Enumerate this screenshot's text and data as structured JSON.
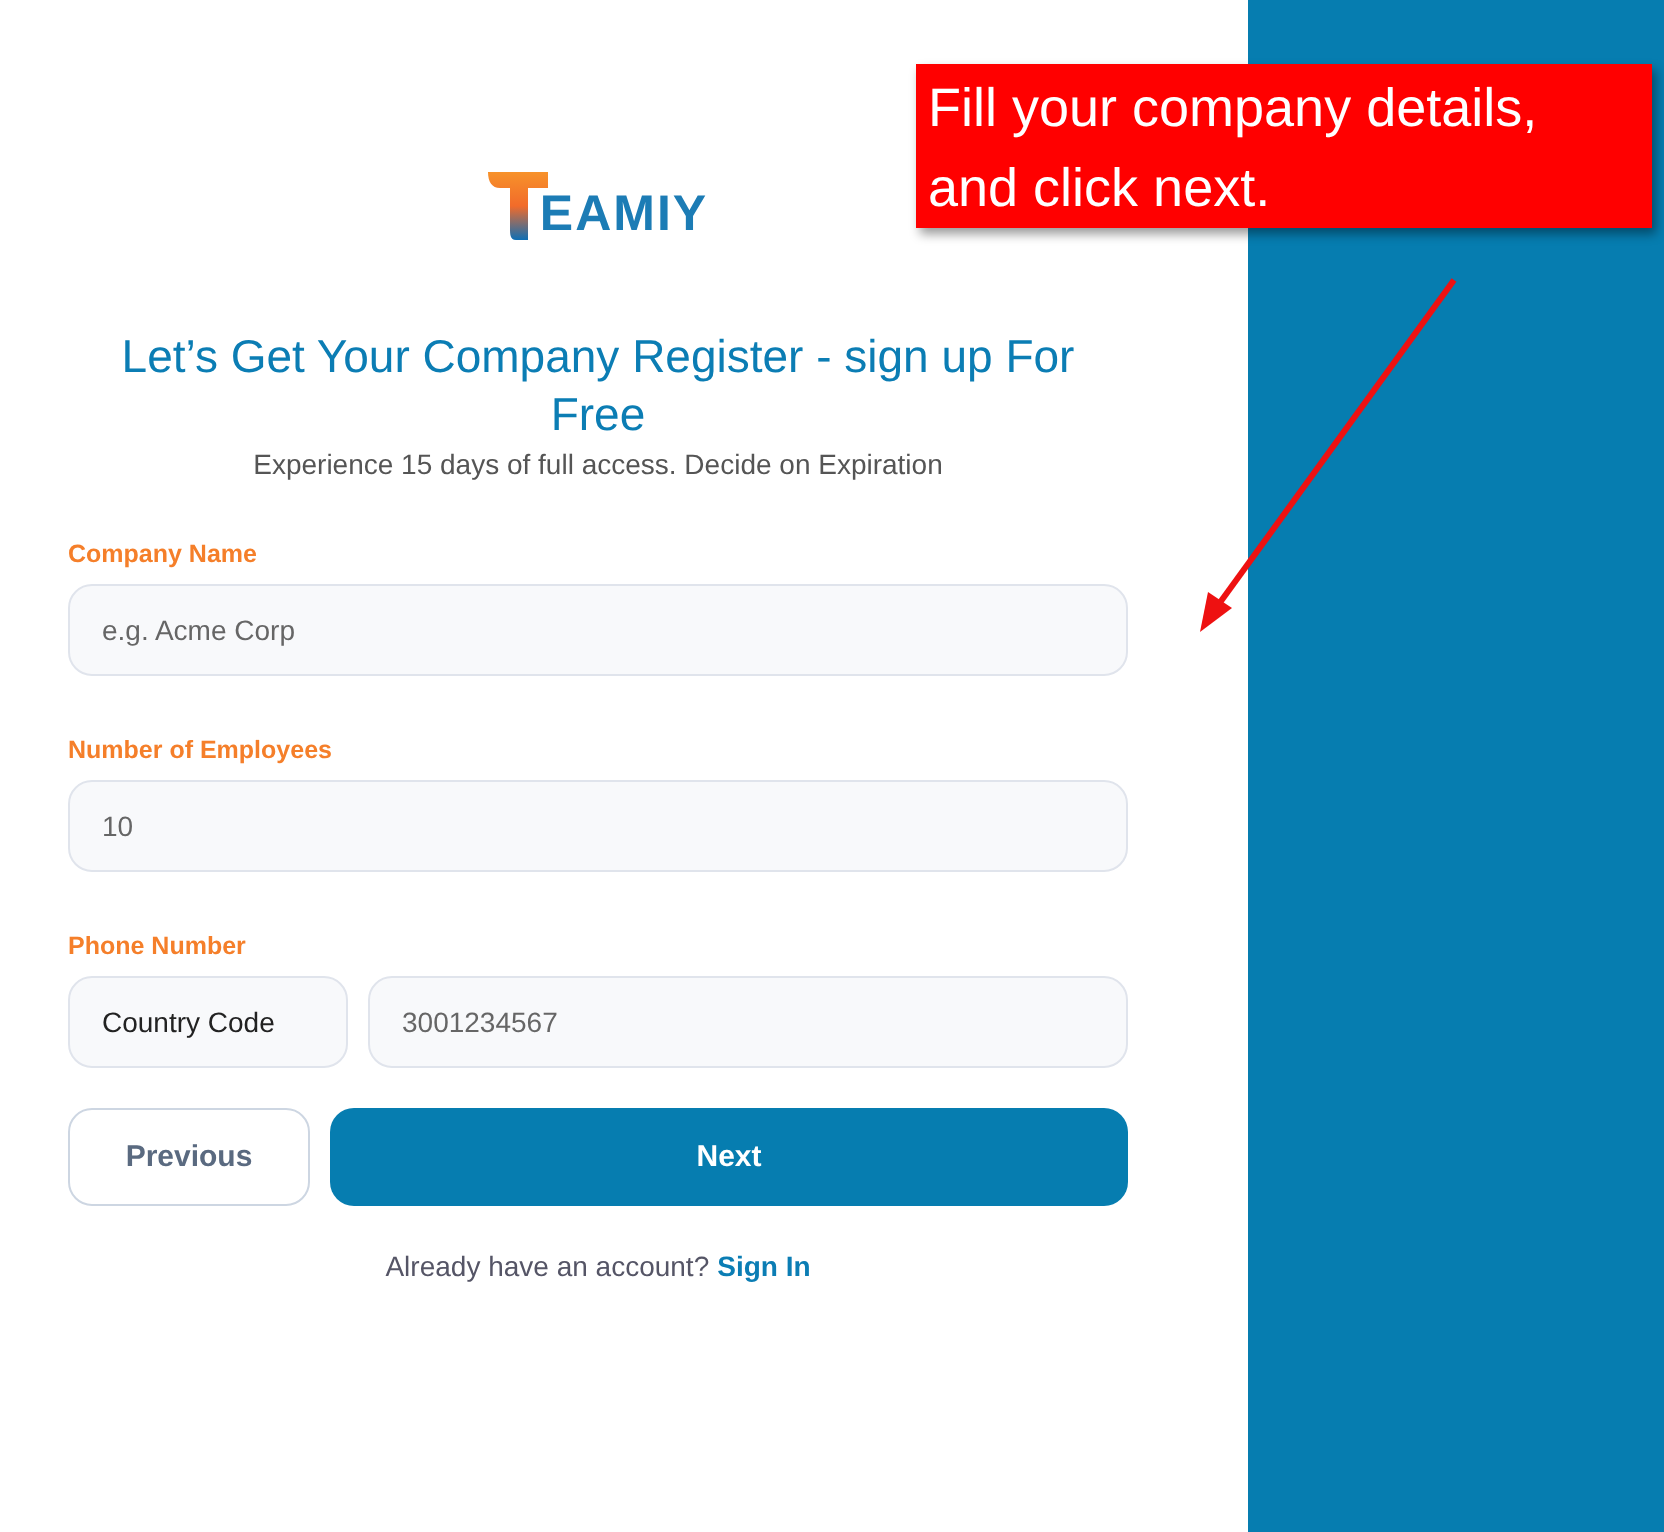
{
  "logo": {
    "text": "EAMIY"
  },
  "heading": "Let’s Get Your Company Register - sign up For Free",
  "subheading": "Experience 15 days of full access. Decide on Expiration",
  "fields": [
    {
      "kind": "text",
      "label": "Company Name",
      "placeholder": "e.g. Acme Corp"
    },
    {
      "kind": "text",
      "label": "Number of Employees",
      "placeholder": "10"
    },
    {
      "kind": "phone",
      "label": "Phone Number",
      "code": "Country Code",
      "placeholder": "3001234567"
    }
  ],
  "buttons": [
    {
      "kind": "secondary",
      "label": "Previous"
    },
    {
      "kind": "primary",
      "label": "Next"
    }
  ],
  "signin": {
    "text": "Already have an account?",
    "link": "Sign In"
  },
  "callout": {
    "text": "Fill your company details, and click next."
  }
}
